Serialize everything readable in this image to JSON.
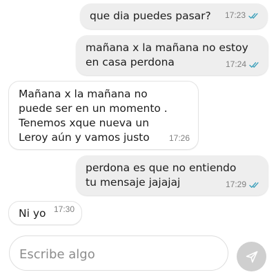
{
  "colors": {
    "outgoing_bubble": "#eeeeee",
    "incoming_bubble": "#ffffff",
    "read_ticks": "#3a9fba",
    "send_button": "#cfcfcf"
  },
  "messages": [
    {
      "direction": "outgoing",
      "text": "que dia puedes pasar?",
      "time": "17:23",
      "status_icon": "double-check-icon"
    },
    {
      "direction": "outgoing",
      "text": "mañana x la mañana no estoy\nen casa perdona",
      "time": "17:24",
      "status_icon": "double-check-icon"
    },
    {
      "direction": "incoming",
      "text": "Mañana x la mañana no\npuede ser en un momento .\nTenemos xque nueva un\nLeroy aún y vamos justo",
      "time": "17:26"
    },
    {
      "direction": "outgoing",
      "text": "perdona es que no entiendo\ntu mensaje jajajaj",
      "time": "17:29",
      "status_icon": "double-check-icon"
    },
    {
      "direction": "incoming",
      "text": "Ni yo",
      "time": "17:30"
    }
  ],
  "composer": {
    "placeholder": "Escribe algo",
    "value": "",
    "send_icon": "send-icon"
  }
}
